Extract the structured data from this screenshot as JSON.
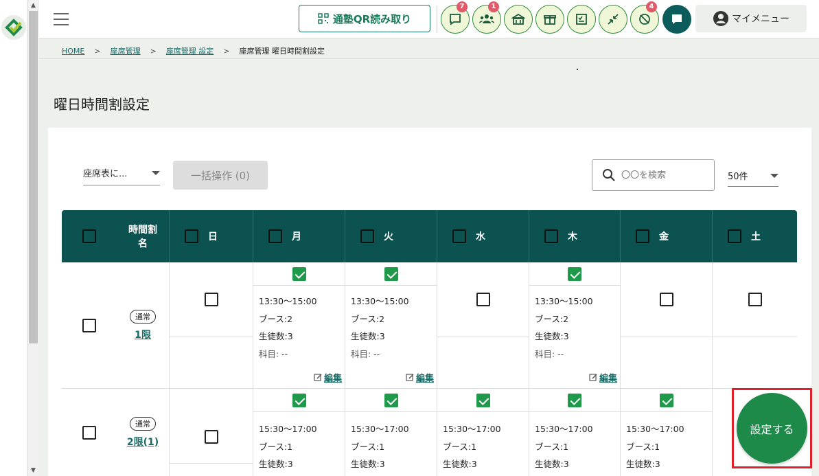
{
  "header": {
    "qr_label": "通塾QR読み取り",
    "badges": {
      "messages": "7",
      "students": "1",
      "alerts": "4"
    },
    "mymenu_label": "マイメニュー"
  },
  "breadcrumb": {
    "home": "HOME",
    "level1": "座席管理",
    "level2": "座席管理 設定",
    "current": "座席管理 曜日時間割設定"
  },
  "page_title": "曜日時間割設定",
  "toolbar": {
    "seat_select": "座席表に...",
    "bulk_label": "一括操作 (0)",
    "search_placeholder": "〇〇を検索",
    "per_page": "50件"
  },
  "table": {
    "timetable_header": "時間割名",
    "days": [
      "日",
      "月",
      "火",
      "水",
      "木",
      "金",
      "土"
    ],
    "rows": [
      {
        "chip": "通常",
        "name": "1限",
        "slots": {
          "mon": {
            "time": "13:30〜15:00",
            "booth": "ブース:2",
            "students": "生徒数:3",
            "subject": "科目: --",
            "edit": "編集"
          },
          "tue": {
            "time": "13:30〜15:00",
            "booth": "ブース:2",
            "students": "生徒数:3",
            "subject": "科目: --",
            "edit": "編集"
          },
          "thu": {
            "time": "13:30〜15:00",
            "booth": "ブース:2",
            "students": "生徒数:3",
            "subject": "科目: --",
            "edit": "編集"
          }
        }
      },
      {
        "chip": "通常",
        "name": "2限(1)",
        "slots": {
          "mon": {
            "time": "15:30〜17:00",
            "booth": "ブース:1",
            "students": "生徒数:3"
          },
          "tue": {
            "time": "15:30〜17:00",
            "booth": "ブース:1",
            "students": "生徒数:3"
          },
          "wed": {
            "time": "15:30〜17:00",
            "booth": "ブース:1",
            "students": "生徒数:3"
          },
          "thu": {
            "time": "15:30〜17:00",
            "booth": "ブース:1",
            "students": "生徒数:3"
          },
          "fri": {
            "time": "15:30〜17:00",
            "booth": "ブース:1",
            "students": "生徒数:3"
          }
        }
      }
    ]
  },
  "fab_label": "設定する",
  "colors": {
    "primary": "#0b5250",
    "accent": "#1f9a4a",
    "badge": "#e05a6a",
    "highlight": "#e0202a"
  }
}
